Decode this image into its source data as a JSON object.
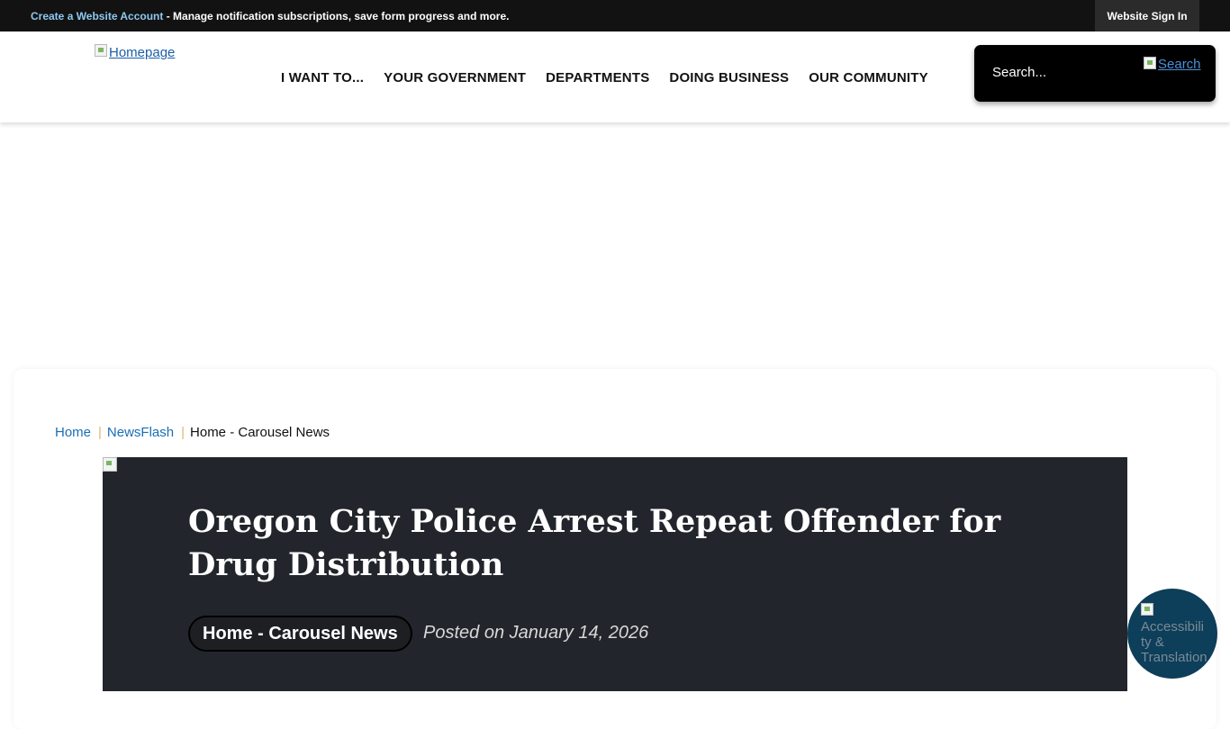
{
  "topbar": {
    "create_link": "Create a Website Account",
    "create_desc": " - Manage notification subscriptions, save form progress and more.",
    "signin_label": "Website Sign In"
  },
  "header": {
    "logo_alt": "Homepage",
    "nav": [
      "I WANT TO...",
      "YOUR GOVERNMENT",
      "DEPARTMENTS",
      "DOING BUSINESS",
      "OUR COMMUNITY"
    ],
    "search_placeholder": "Search...",
    "search_button_alt": "Search"
  },
  "breadcrumb": {
    "items": [
      "Home",
      "NewsFlash"
    ],
    "current": "Home - Carousel News"
  },
  "article": {
    "title": "Oregon City Police Arrest Repeat Offender for Drug Distribution",
    "category": "Home - Carousel News",
    "posted": "Posted on January 14, 2026"
  },
  "accessibility_widget": {
    "alt": "Accessibility & Translation"
  },
  "colors": {
    "topbar_bg": "#121212",
    "link_blue": "#1a6fb5",
    "article_bg": "#22252b",
    "widget_bg": "#0d3e5a"
  }
}
